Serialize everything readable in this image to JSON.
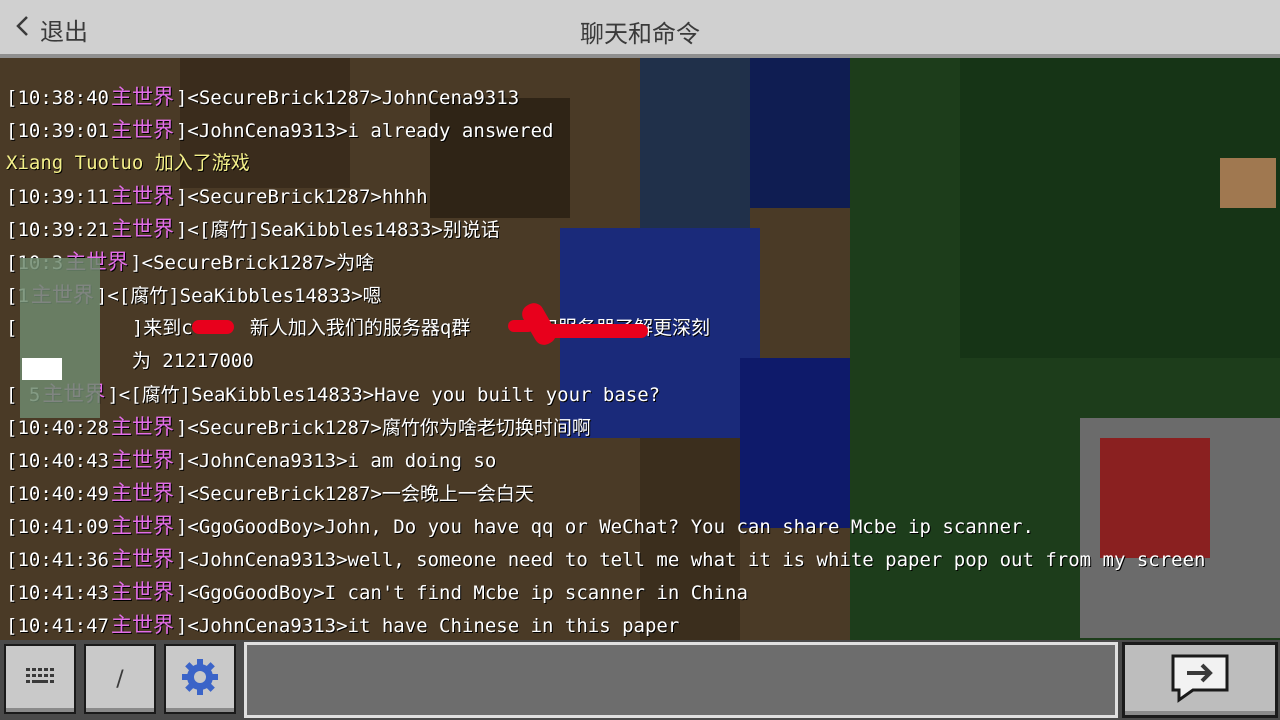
{
  "header": {
    "back_label": "退出",
    "title": "聊天和命令"
  },
  "chat": {
    "world_label": "主世界",
    "lines": [
      {
        "type": "chat",
        "time": "[10:38:40",
        "sender": "]<SecureBrick1287>",
        "text": "JohnCena9313"
      },
      {
        "type": "chat",
        "time": "[10:39:01",
        "sender": "]<JohnCena9313>",
        "text": "i already answered"
      },
      {
        "type": "system",
        "text": "Xiang Tuotuo 加入了游戏"
      },
      {
        "type": "chat",
        "time": "[10:39:11",
        "sender": "]<SecureBrick1287>",
        "text": "hhhh"
      },
      {
        "type": "chat",
        "time": "[10:39:21",
        "sender": "]<[腐竹]SeaKibbles14833>",
        "text": "别说话"
      },
      {
        "type": "chat",
        "time": "[10:3",
        "sender": "]<SecureBrick1287>",
        "text": "为啥"
      },
      {
        "type": "chat",
        "time": "[1",
        "sender": "]<[腐竹]SeaKibbles14833>",
        "text": "嗯"
      },
      {
        "type": "plain",
        "text": "[          ]来到c     新人加入我们的服务器q群      和服务器了解更深刻"
      },
      {
        "type": "plain",
        "text": "           为 21217000"
      },
      {
        "type": "chat",
        "time": "[      5",
        "sender": "]<[腐竹]SeaKibbles14833>",
        "text": "Have you built your base?"
      },
      {
        "type": "chat",
        "time": "[10:40:28",
        "sender": "]<SecureBrick1287>",
        "text": "腐竹你为啥老切换时间啊"
      },
      {
        "type": "chat",
        "time": "[10:40:43",
        "sender": "]<JohnCena9313>",
        "text": "i am doing so"
      },
      {
        "type": "chat",
        "time": "[10:40:49",
        "sender": "]<SecureBrick1287>",
        "text": "一会晚上一会白天"
      },
      {
        "type": "chat",
        "time": "[10:41:09",
        "sender": "]<GgoGoodBoy>",
        "text": "John, Do you have qq or WeChat? You can share Mcbe ip scanner."
      },
      {
        "type": "chat",
        "time": "[10:41:36",
        "sender": "]<JohnCena9313>",
        "text": "well, someone need to tell me what it is white paper pop out from my screen"
      },
      {
        "type": "chat",
        "time": "[10:41:43",
        "sender": "]<GgoGoodBoy>",
        "text": "I can't find Mcbe ip scanner in China"
      },
      {
        "type": "chat",
        "time": "[10:41:47",
        "sender": "]<JohnCena9313>",
        "text": "it have Chinese in this paper"
      }
    ]
  },
  "toolbar": {
    "keyboard_icon": "keyboard-icon",
    "slash_label": "/",
    "settings_icon": "gear-icon",
    "input_value": "",
    "send_icon": "send-arrow-icon"
  },
  "colors": {
    "world": "#e36ee8",
    "system": "#f4f08a",
    "header_bg": "#d0d0d0"
  }
}
